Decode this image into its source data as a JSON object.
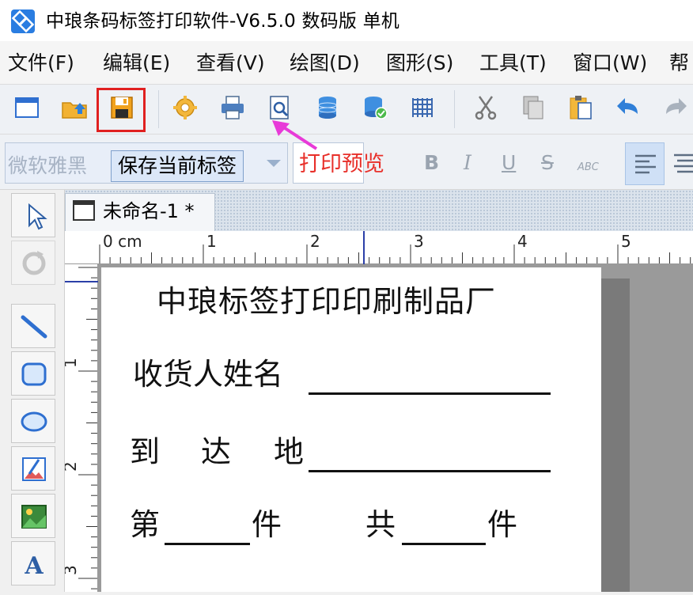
{
  "app": {
    "title": "中琅条码标签打印软件-V6.5.0 数码版 单机"
  },
  "menu": [
    {
      "label": "文件(F)"
    },
    {
      "label": "编辑(E)"
    },
    {
      "label": "查看(V)"
    },
    {
      "label": "绘图(D)"
    },
    {
      "label": "图形(S)"
    },
    {
      "label": "工具(T)"
    },
    {
      "label": "窗口(W)"
    },
    {
      "label": "帮"
    }
  ],
  "toolbar": {
    "icons": [
      "new-label-icon",
      "open-icon",
      "save-icon",
      "settings-icon",
      "print-icon",
      "print-preview-icon",
      "database-icon",
      "database-settings-icon",
      "grid-icon",
      "cut-icon",
      "copy-icon",
      "paste-icon",
      "undo-icon",
      "redo-icon"
    ]
  },
  "formatbar": {
    "font_name": "微软雅黑",
    "save_tooltip": "保存当前标签",
    "preview_annotation": "打印预览",
    "bold": "B",
    "italic": "I",
    "underline": "U",
    "strike": "S",
    "abc": "ABC"
  },
  "document": {
    "tab_title": "未命名-1 *"
  },
  "ruler": {
    "h_labels": [
      "0 cm",
      "1",
      "2",
      "3",
      "4",
      "5"
    ],
    "v_labels": [
      "1",
      "2",
      "3"
    ]
  },
  "label": {
    "title": "中琅标签打印印刷制品厂",
    "receiver": "收货人姓名",
    "dest_1": "到",
    "dest_2": "达",
    "dest_3": "地",
    "piece_1": "第",
    "piece_2": "件",
    "total": "共",
    "piece_3": "件"
  },
  "colors": {
    "highlight_red": "#e02020",
    "annotation_red": "#e8302a",
    "arrow_magenta": "#e83ad8",
    "ruler_line": "#2b3fa8"
  }
}
